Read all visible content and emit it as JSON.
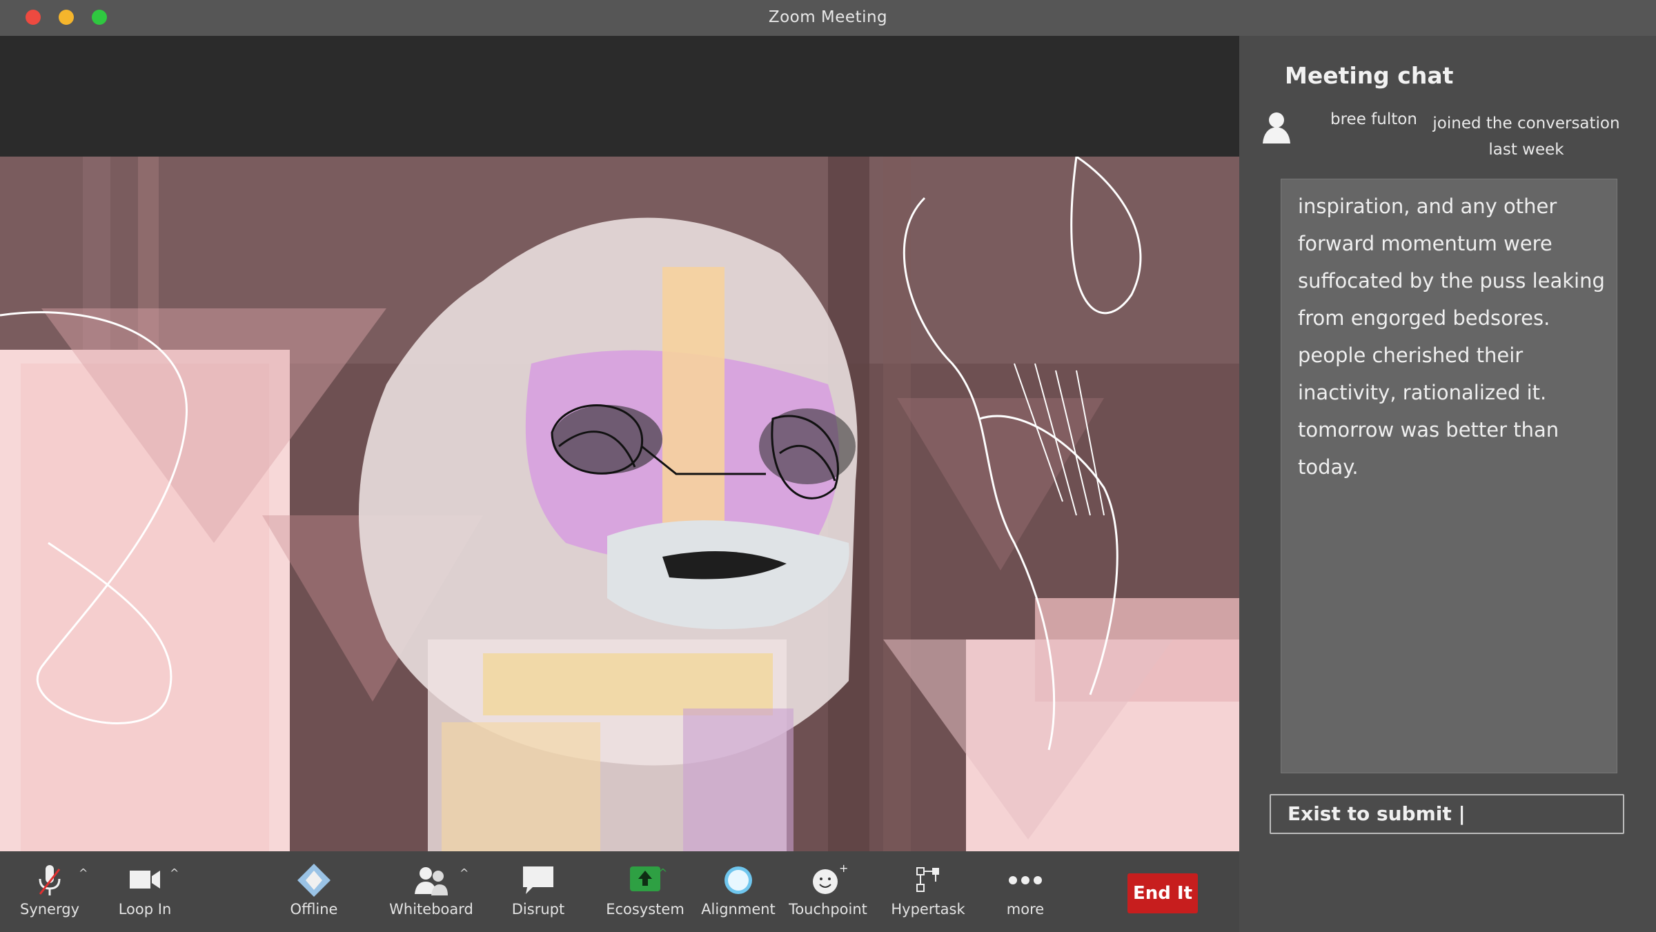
{
  "window": {
    "title": "Zoom Meeting"
  },
  "chat": {
    "title": "Meeting chat",
    "notice": {
      "name": "bree fulton",
      "line1": "joined the conversation",
      "line2": "last week"
    },
    "message": "inspiration, and any other forward momentum were suffocated by the puss leaking from engorged bedsores. people cherished their inactivity, rationalized it. tomorrow was better than today.",
    "input_value": "Exist to submit |"
  },
  "toolbar": {
    "items": [
      {
        "label": "Synergy",
        "icon": "muted-microphone-icon"
      },
      {
        "label": "Loop In",
        "icon": "video-camera-icon"
      },
      {
        "label": "Offline",
        "icon": "diamond-shield-icon"
      },
      {
        "label": "Whiteboard",
        "icon": "participants-icon"
      },
      {
        "label": "Disrupt",
        "icon": "speech-bubble-icon"
      },
      {
        "label": "Ecosystem",
        "icon": "share-screen-icon"
      },
      {
        "label": "Alignment",
        "icon": "egg-circle-icon"
      },
      {
        "label": "Touchpoint",
        "icon": "smiley-plus-icon"
      },
      {
        "label": "Hypertask",
        "icon": "network-icon"
      },
      {
        "label": "more",
        "icon": "ellipsis-icon"
      }
    ],
    "end_label": "End It"
  },
  "colors": {
    "end_button": "#c71e1e",
    "share_icon": "#2ea043",
    "alignment_icon": "#6fc6ee"
  }
}
